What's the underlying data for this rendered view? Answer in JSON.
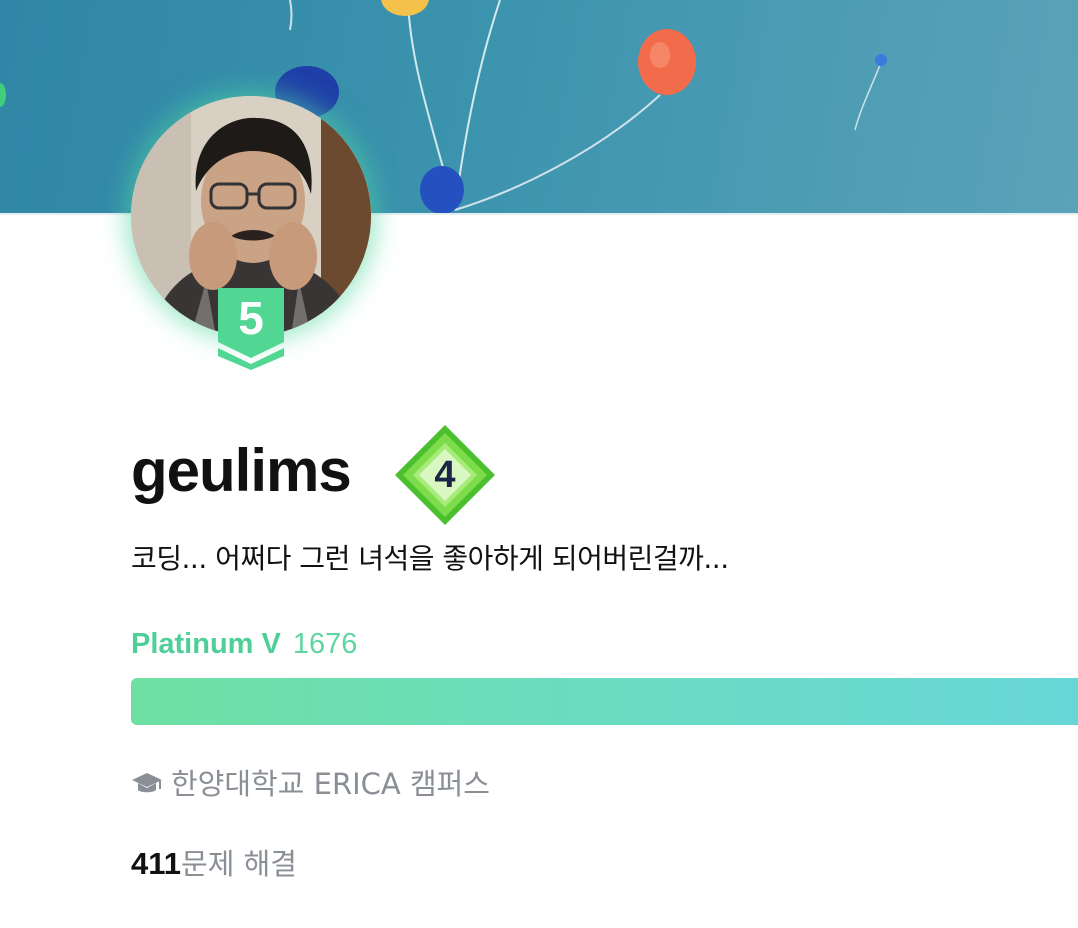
{
  "profile": {
    "username": "geulims",
    "bio": "코딩... 어쩌다 그런 녀석을 좋아하게 되어버린걸까...",
    "tier_number": "5",
    "class_number": "4",
    "tier_name": "Platinum V",
    "rating": "1676",
    "progress_fraction": 1.0,
    "school": "한양대학교 ERICA 캠퍼스",
    "solved_count": "411",
    "solved_suffix": "문제 해결"
  },
  "icons": {
    "school": "graduation-cap-icon",
    "tier": "tier-shield-icon",
    "class": "class-diamond-icon"
  },
  "colors": {
    "tier_accent": "#4fcf98",
    "class_green": "#5cc93d",
    "progress_start": "#6ee0a3",
    "progress_end": "#67d6d9",
    "muted_text": "#8a8f96"
  }
}
